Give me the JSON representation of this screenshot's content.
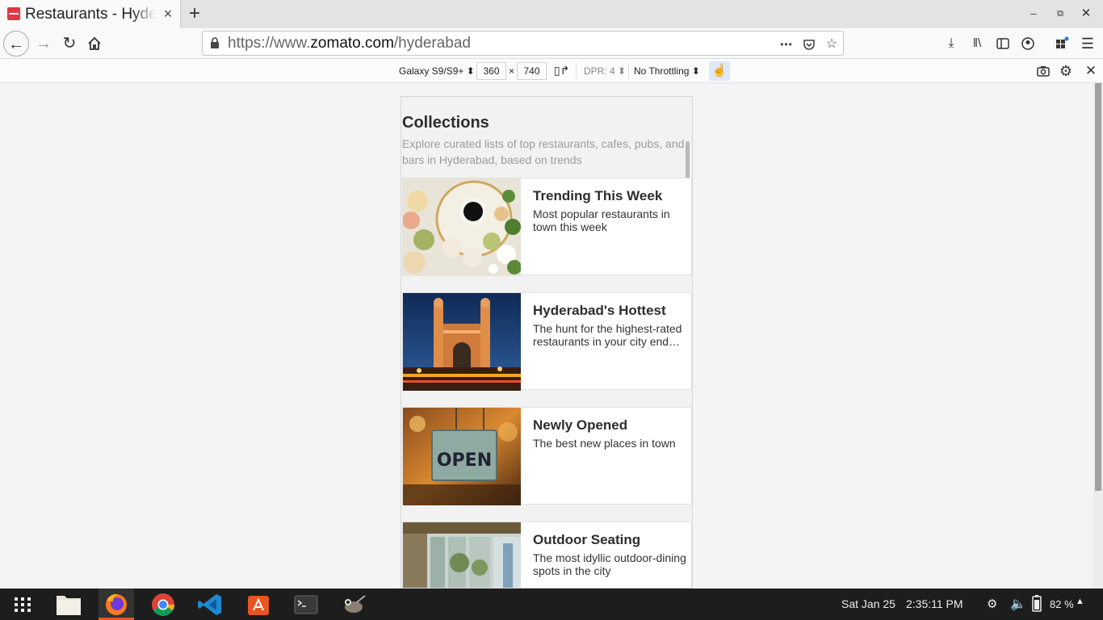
{
  "browser": {
    "tab_title": "Restaurants - Hyderabad",
    "tab_close": "×",
    "new_tab": "+",
    "url_prefix": "https://www.",
    "url_host": "zomato.com",
    "url_path": "/hyderabad",
    "url_more": "•••"
  },
  "rdm": {
    "device": "Galaxy S9/S9+ ⬍",
    "width": "360",
    "times": "×",
    "height": "740",
    "dpr": "DPR: 4 ⬍",
    "throttling": "No Throttling ⬍"
  },
  "page": {
    "title": "Collections",
    "subtitle": "Explore curated lists of top restaurants, cafes, pubs, and bars in Hyderabad, based on trends",
    "collections": [
      {
        "name": "Trending This Week",
        "description": "Most popular restaurants in town this week"
      },
      {
        "name": "Hyderabad's Hottest",
        "description": "The hunt for the highest-rated restaurants in your city end…"
      },
      {
        "name": "Newly Opened",
        "description": "The best new places in town"
      },
      {
        "name": "Outdoor Seating",
        "description": "The most idyllic outdoor-dining spots in the city"
      }
    ]
  },
  "taskbar": {
    "date": "Sat Jan 25",
    "time": "2:35:11 PM",
    "battery": "82 %"
  }
}
